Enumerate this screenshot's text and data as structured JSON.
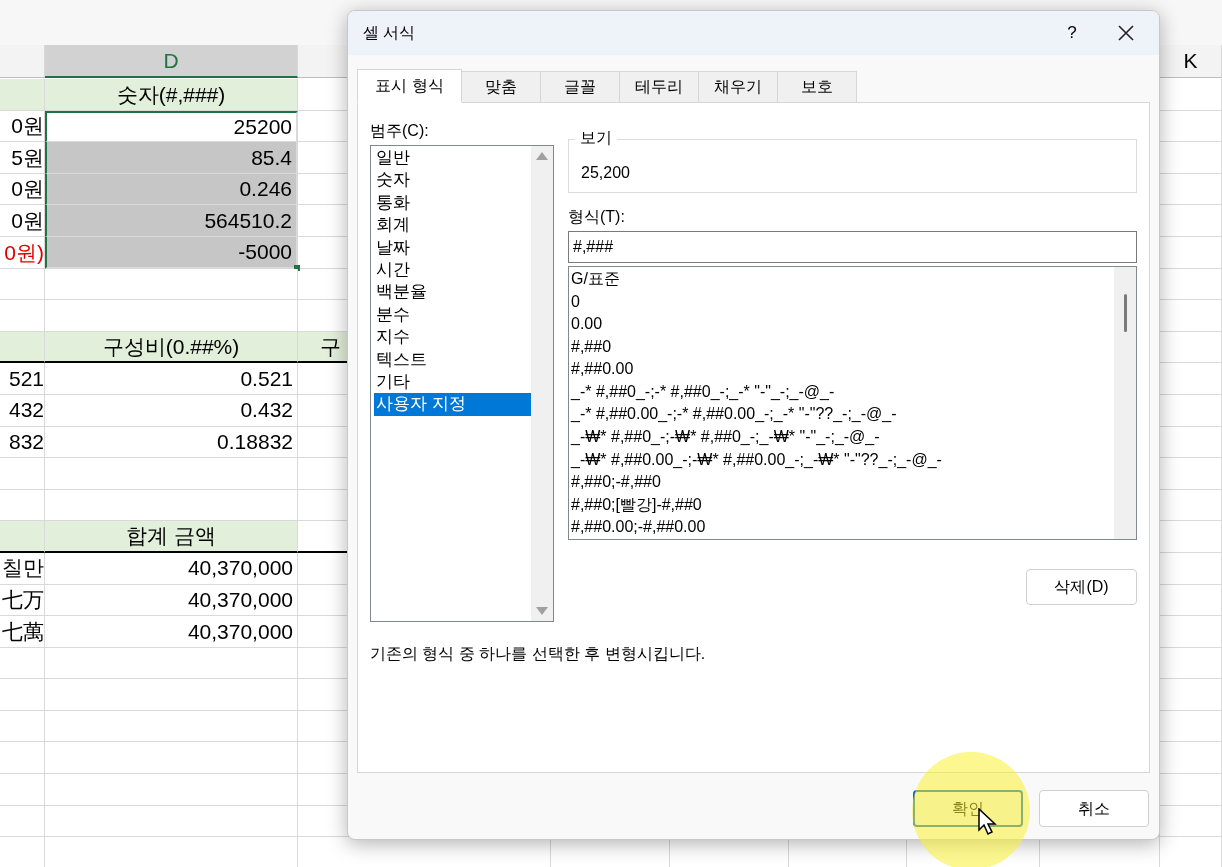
{
  "sheet": {
    "column_headers": [
      {
        "label": "D"
      },
      {
        "label": "K"
      }
    ],
    "rows": [
      {
        "kind": "header",
        "d": "숫자(#,###)",
        "selected": false,
        "active": false
      },
      {
        "kind": "value",
        "a": "0원",
        "d": "25200",
        "selected": true,
        "active": true
      },
      {
        "kind": "value",
        "a": "5원",
        "d": "85.4",
        "selected": true,
        "active": false
      },
      {
        "kind": "value",
        "a": "0원",
        "d": "0.246",
        "selected": true,
        "active": false
      },
      {
        "kind": "value",
        "a": "0원",
        "d": "564510.2",
        "selected": true,
        "active": false
      },
      {
        "kind": "value",
        "a": "0원)",
        "a_negative": true,
        "d": "-5000",
        "selected": true,
        "active": false
      },
      {
        "kind": "blank",
        "selected": false,
        "active": false
      },
      {
        "kind": "blank",
        "selected": false,
        "active": false
      },
      {
        "kind": "header",
        "d": "구성비(0.##%)",
        "e": "구",
        "selected": false,
        "active": false
      },
      {
        "kind": "value",
        "a": "521",
        "d": "0.521",
        "selected": false,
        "active": false
      },
      {
        "kind": "value",
        "a": "432",
        "d": "0.432",
        "selected": false,
        "active": false
      },
      {
        "kind": "value",
        "a": "832",
        "d": "0.18832",
        "selected": false,
        "active": false
      },
      {
        "kind": "blank",
        "selected": false,
        "active": false
      },
      {
        "kind": "blank",
        "selected": false,
        "active": false
      },
      {
        "kind": "header",
        "d": "합계 금액",
        "selected": false,
        "active": false
      },
      {
        "kind": "value",
        "a": "칠만",
        "d": "40,370,000",
        "selected": false,
        "active": false
      },
      {
        "kind": "value",
        "a": "七万",
        "d": "40,370,000",
        "selected": false,
        "active": false
      },
      {
        "kind": "value",
        "a": "七萬",
        "d": "40,370,000",
        "selected": false,
        "active": false
      }
    ]
  },
  "dialog": {
    "title": "셀 서식",
    "help": "?",
    "tabs": [
      {
        "label": "표시 형식",
        "selected": true
      },
      {
        "label": "맞춤",
        "selected": false
      },
      {
        "label": "글꼴",
        "selected": false
      },
      {
        "label": "테두리",
        "selected": false
      },
      {
        "label": "채우기",
        "selected": false
      },
      {
        "label": "보호",
        "selected": false
      }
    ],
    "category_label": "범주(C):",
    "categories": [
      {
        "label": "일반",
        "selected": false
      },
      {
        "label": "숫자",
        "selected": false
      },
      {
        "label": "통화",
        "selected": false
      },
      {
        "label": "회계",
        "selected": false
      },
      {
        "label": "날짜",
        "selected": false
      },
      {
        "label": "시간",
        "selected": false
      },
      {
        "label": "백분율",
        "selected": false
      },
      {
        "label": "분수",
        "selected": false
      },
      {
        "label": "지수",
        "selected": false
      },
      {
        "label": "텍스트",
        "selected": false
      },
      {
        "label": "기타",
        "selected": false
      },
      {
        "label": "사용자 지정",
        "selected": true
      }
    ],
    "preview": {
      "label": "보기",
      "value": "25,200"
    },
    "format_label": "형식(T):",
    "format_value": "#,###",
    "formats": [
      {
        "label": "G/표준",
        "selected": false
      },
      {
        "label": "0",
        "selected": false
      },
      {
        "label": "0.00",
        "selected": false
      },
      {
        "label": "#,##0",
        "selected": false
      },
      {
        "label": "#,##0.00",
        "selected": false
      },
      {
        "label": "_-* #,##0_-;-* #,##0_-;_-* \"-\"_-;_-@_-",
        "selected": false
      },
      {
        "label": "_-* #,##0.00_-;-* #,##0.00_-;_-* \"-\"??_-;_-@_-",
        "selected": false
      },
      {
        "label": "_-₩* #,##0_-;-₩* #,##0_-;_-₩* \"-\"_-;_-@_-",
        "selected": false
      },
      {
        "label": "_-₩* #,##0.00_-;-₩* #,##0.00_-;_-₩* \"-\"??_-;_-@_-",
        "selected": false
      },
      {
        "label": "#,##0;-#,##0",
        "selected": false
      },
      {
        "label": "#,##0;[빨강]-#,##0",
        "selected": false
      },
      {
        "label": "#,##0.00;-#,##0.00",
        "selected": false
      }
    ],
    "delete_button": "삭제(D)",
    "description": "기존의 형식 중 하나를 선택한 후 변형시킵니다.",
    "ok_button": "확인",
    "cancel_button": "취소"
  }
}
